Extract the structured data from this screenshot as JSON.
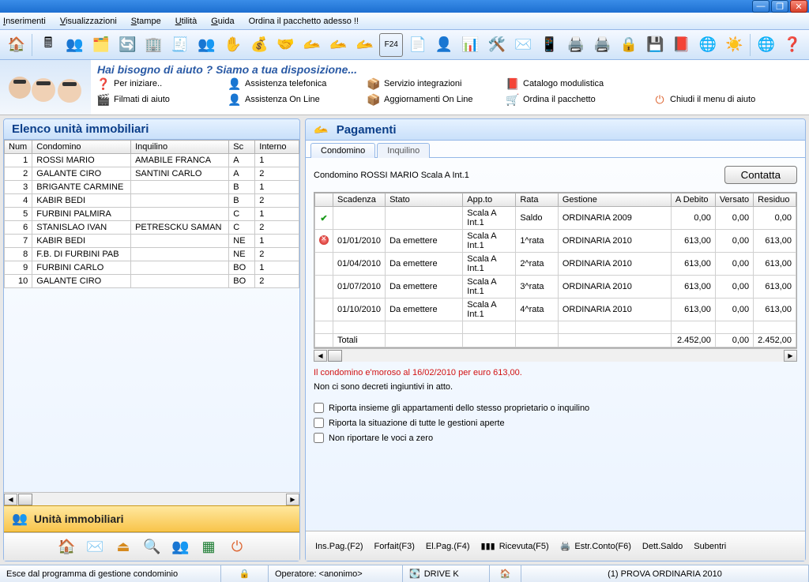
{
  "menus": {
    "ins": "Inserimenti",
    "vis": "Visualizzazioni",
    "st": "Stampe",
    "ut": "Utilità",
    "gu": "Guida",
    "ord": "Ordina il pacchetto adesso !!"
  },
  "help": {
    "title": "Hai bisogno di aiuto ?  Siamo a tua disposizione...",
    "links": [
      [
        "Per iniziare..",
        "Assistenza telefonica",
        "Servizio integrazioni",
        "Catalogo modulistica",
        ""
      ],
      [
        "Filmati di aiuto",
        "Assistenza On Line",
        "Aggiornamenti On Line",
        "Ordina il pacchetto",
        "Chiudi il menu di aiuto"
      ]
    ]
  },
  "leftPanel": {
    "title": "Elenco unità immobiliari",
    "cols": [
      "Num",
      "Condomino",
      "Inquilino",
      "Sc",
      "Interno"
    ],
    "rows": [
      {
        "num": 1,
        "cond": "ROSSI MARIO",
        "inq": "AMABILE FRANCA",
        "sc": "A",
        "int": "1"
      },
      {
        "num": 2,
        "cond": "GALANTE CIRO",
        "inq": "SANTINI CARLO",
        "sc": "A",
        "int": "2"
      },
      {
        "num": 3,
        "cond": "BRIGANTE CARMINE",
        "inq": "",
        "sc": "B",
        "int": "1"
      },
      {
        "num": 4,
        "cond": "KABIR BEDI",
        "inq": "",
        "sc": "B",
        "int": "2"
      },
      {
        "num": 5,
        "cond": "FURBINI PALMIRA",
        "inq": "",
        "sc": "C",
        "int": "1"
      },
      {
        "num": 6,
        "cond": "STANISLAO IVAN",
        "inq": "PETRESCKU SAMAN",
        "sc": "C",
        "int": "2"
      },
      {
        "num": 7,
        "cond": "KABIR BEDI",
        "inq": "",
        "sc": "NE",
        "int": "1"
      },
      {
        "num": 8,
        "cond": "F.B. DI FURBINI PAB",
        "inq": "",
        "sc": "NE",
        "int": "2"
      },
      {
        "num": 9,
        "cond": "FURBINI CARLO",
        "inq": "",
        "sc": "BO",
        "int": "1"
      },
      {
        "num": 10,
        "cond": "GALANTE CIRO",
        "inq": "",
        "sc": "BO",
        "int": "2"
      }
    ],
    "footer": "Unità immobiliari"
  },
  "rightPanel": {
    "title": "Pagamenti",
    "tabs": [
      "Condomino",
      "Inquilino"
    ],
    "subject": "Condomino ROSSI MARIO Scala A Int.1",
    "contactBtn": "Contatta",
    "cols": [
      "Scadenza",
      "Stato",
      "App.to",
      "Rata",
      "Gestione",
      "A Debito",
      "Versato",
      "Residuo"
    ],
    "rows": [
      {
        "mark": "ok",
        "scad": "",
        "stato": "",
        "app": "Scala A Int.1",
        "rata": "Saldo",
        "gest": "ORDINARIA 2009",
        "deb": "0,00",
        "ver": "0,00",
        "res": "0,00"
      },
      {
        "mark": "bad",
        "scad": "01/01/2010",
        "stato": "Da emettere",
        "app": "Scala A Int.1",
        "rata": "1^rata",
        "gest": "ORDINARIA 2010",
        "deb": "613,00",
        "ver": "0,00",
        "res": "613,00"
      },
      {
        "mark": "",
        "scad": "01/04/2010",
        "stato": "Da emettere",
        "app": "Scala A Int.1",
        "rata": "2^rata",
        "gest": "ORDINARIA 2010",
        "deb": "613,00",
        "ver": "0,00",
        "res": "613,00"
      },
      {
        "mark": "",
        "scad": "01/07/2010",
        "stato": "Da emettere",
        "app": "Scala A Int.1",
        "rata": "3^rata",
        "gest": "ORDINARIA 2010",
        "deb": "613,00",
        "ver": "0,00",
        "res": "613,00"
      },
      {
        "mark": "",
        "scad": "01/10/2010",
        "stato": "Da emettere",
        "app": "Scala A Int.1",
        "rata": "4^rata",
        "gest": "ORDINARIA 2010",
        "deb": "613,00",
        "ver": "0,00",
        "res": "613,00"
      }
    ],
    "totals": {
      "label": "Totali",
      "deb": "2.452,00",
      "ver": "0,00",
      "res": "2.452,00"
    },
    "warning": "Il condomino e'moroso al 16/02/2010 per euro 613,00.",
    "noDecree": "Non ci sono decreti ingiuntivi in atto.",
    "chk1": "Riporta insieme gli appartamenti dello stesso proprietario o inquilino",
    "chk2": "Riporta la situazione di tutte le gestioni aperte",
    "chk3": "Non riportare le voci a zero",
    "footerBtns": [
      "Ins.Pag.(F2)",
      "Forfait(F3)",
      "El.Pag.(F4)",
      "Ricevuta(F5)",
      "Estr.Conto(F6)",
      "Dett.Saldo",
      "Subentri"
    ]
  },
  "status": {
    "left": "Esce dal programma di gestione condominio",
    "op": "Operatore: <anonimo>",
    "drive": "DRIVE K",
    "right": "(1) PROVA  ORDINARIA 2010"
  }
}
